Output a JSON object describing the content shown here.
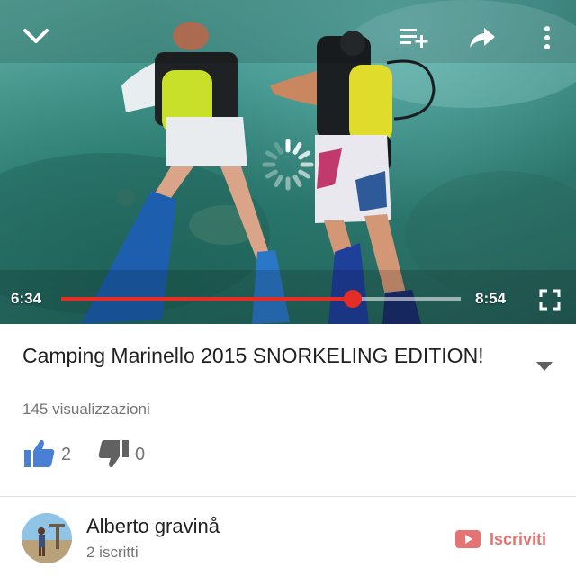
{
  "player": {
    "current_time": "6:34",
    "total_time": "8:54",
    "progress": 0.73,
    "controls": {
      "collapse_icon": "chevron-down-icon",
      "queue_icon": "add-to-queue-icon",
      "share_icon": "share-icon",
      "more_icon": "more-vert-icon",
      "fullscreen_icon": "fullscreen-icon"
    },
    "accent_color": "#e52d27"
  },
  "video": {
    "title": "Camping Marinello 2015 SNORKELING EDITION!",
    "views": "145 visualizzazioni",
    "likes": "2",
    "dislikes": "0",
    "expand_icon": "expand-arrow-icon",
    "like_icon": "thumbs-up-icon",
    "dislike_icon": "thumbs-down-icon",
    "like_color": "#4a7fd6"
  },
  "channel": {
    "name": "Alberto gravinå",
    "subscribers": "2 iscritti",
    "subscribe_label": "Iscriviti",
    "subscribe_color": "#e57373"
  }
}
